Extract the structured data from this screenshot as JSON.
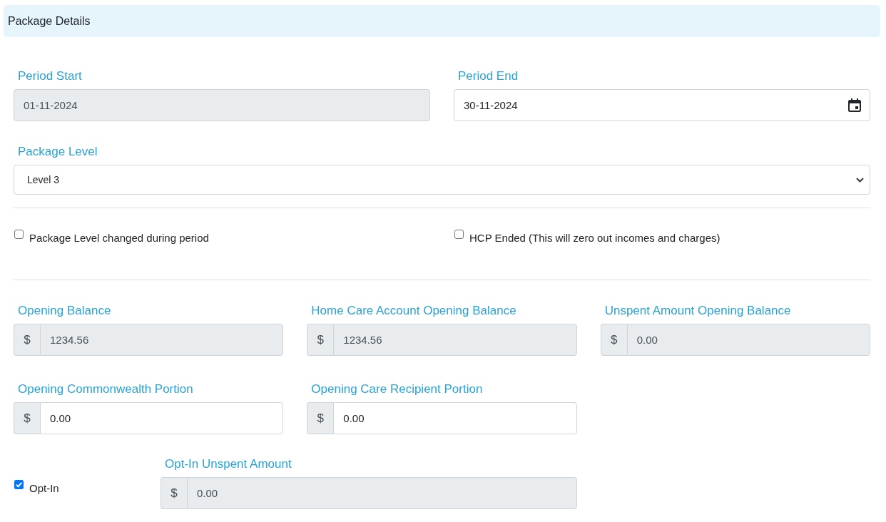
{
  "header": {
    "title": "Package Details"
  },
  "period": [
    {
      "label": "Period Start",
      "value": "01-11-2024",
      "disabled": true,
      "kind": "text"
    },
    {
      "label": "Period End",
      "value": "30-11-2024",
      "disabled": false,
      "kind": "date"
    }
  ],
  "package_level": {
    "label": "Package Level",
    "value": "Level 3"
  },
  "flags": [
    {
      "label": "Package Level changed during period",
      "checked": false
    },
    {
      "label": "HCP Ended (This will zero out incomes and charges)",
      "checked": false
    }
  ],
  "amounts": [
    {
      "label": "Opening Balance",
      "prefix": "$",
      "value": "1234.56",
      "disabled": true
    },
    {
      "label": "Home Care Account Opening Balance",
      "prefix": "$",
      "value": "1234.56",
      "disabled": true
    },
    {
      "label": "Unspent Amount Opening Balance",
      "prefix": "$",
      "value": "0.00",
      "disabled": true
    },
    {
      "label": "Opening Commonwealth Portion",
      "prefix": "$",
      "value": "0.00",
      "disabled": false
    },
    {
      "label": "Opening Care Recipient Portion",
      "prefix": "$",
      "value": "0.00",
      "disabled": false
    }
  ],
  "opt_in": {
    "label": "Opt-In",
    "checked": true,
    "amount": {
      "label": "Opt-In Unspent Amount",
      "prefix": "$",
      "value": "0.00",
      "disabled": true
    }
  }
}
